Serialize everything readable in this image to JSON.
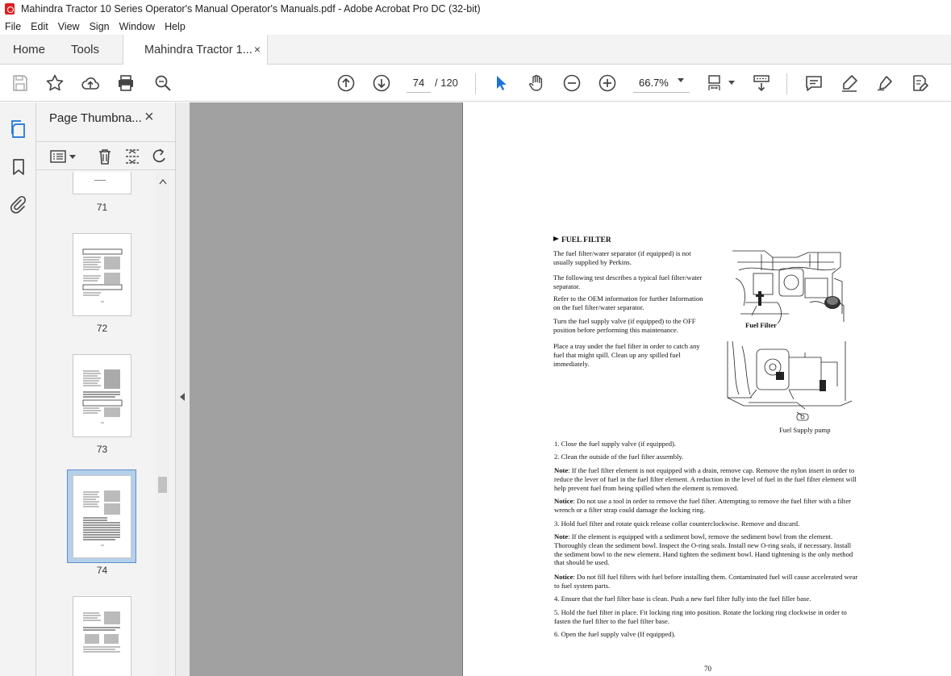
{
  "window": {
    "title": "Mahindra Tractor 10 Series Operator's Manual Operator's Manuals.pdf - Adobe Acrobat Pro DC (32-bit)"
  },
  "menu": [
    "File",
    "Edit",
    "View",
    "Sign",
    "Window",
    "Help"
  ],
  "tabs": {
    "home": "Home",
    "tools": "Tools",
    "document": "Mahindra Tractor 1...",
    "close": "×"
  },
  "toolbar": {
    "current_page": "74",
    "total_pages": "/  120",
    "zoom": "66.7%"
  },
  "panel": {
    "title": "Page Thumbna...",
    "close": "×",
    "thumbnails": [
      {
        "label": "71"
      },
      {
        "label": "72"
      },
      {
        "label": "73"
      },
      {
        "label": "74",
        "selected": true
      },
      {
        "label": ""
      }
    ]
  },
  "page": {
    "heading": "FUEL FILTER",
    "paragraphs": [
      "The fuel filter/water separator (if equipped) is not usually supplied by Perkins.",
      "The following test describes a typical fuel filter/water separator.",
      "Refer to the OEM information for further Information on the fuel filter/water separator.",
      "Turn the fuel supply valve (if equipped) to the OFF position before performing this maintenance.",
      "Place a tray under the fuel filter in order to catch any fuel that might spill. Clean up any spilled fuel immediately."
    ],
    "figure1_caption": "Fuel Filter",
    "figure2_caption": "Fuel Supply pump",
    "steps": [
      {
        "label": "",
        "text": "1. Close the fuel supply valve (if equipped)."
      },
      {
        "label": "",
        "text": "2. Clean the outside of the fuel filter assembly."
      },
      {
        "label": "Note",
        "text": ": If the fuel filter element is not equipped with a drain, remove cap. Remove the nylon insert in order to reduce the lever of fuel in the fuel filter element. A reduction in the level of fuel in the fuel filter element will help prevent fuel from being spilled when the element is removed."
      },
      {
        "label": "Notice",
        "text": ": Do not use a tool in order to remove the fuel filter. Attempting to remove the fuel filter with a filter wrench or a filter strap could damage the locking ring."
      },
      {
        "label": "",
        "text": "3. Hold fuel filter and rotate quick release collar counterclockwise. Remove and discard."
      },
      {
        "label": "Note",
        "text": ": If the element is equipped with a sediment bowl, remove the sediment bowl from the element. Thoroughly clean the sediment bowl. Inspect the O-ring seals. Install new O-ring seals, if necessary. Install the sediment bowl to the new element. Hand tighten the sediment bowl. Hand tightening is the only method that should be used."
      },
      {
        "label": "Notice",
        "text": ": Do not fill fuel filters with fuel before installing them. Contaminated fuel will cause accelerated wear to fuel system parts."
      },
      {
        "label": "",
        "text": "4. Ensure that the fuel filter base is clean. Push a new fuel filter fully into the fuel filler base."
      },
      {
        "label": "",
        "text": "5. Hold the fuel filter in place. Fit locking ring into position. Rotate the locking ring clockwise in order to fasten the fuel filter to the fuel filter base."
      },
      {
        "label": "",
        "text": "6. Open the fuel supply valve (If equipped)."
      }
    ],
    "page_number": "70"
  }
}
